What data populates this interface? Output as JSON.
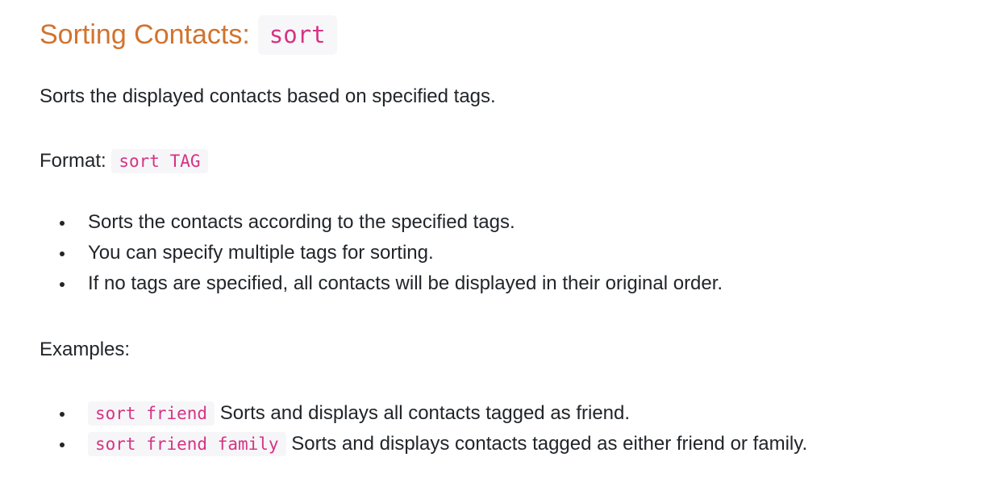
{
  "heading": {
    "title": "Sorting Contacts:",
    "command": "sort"
  },
  "description": "Sorts the displayed contacts based on specified tags.",
  "format": {
    "label": "Format:",
    "code": "sort TAG"
  },
  "notes": [
    "Sorts the contacts according to the specified tags.",
    "You can specify multiple tags for sorting.",
    "If no tags are specified, all contacts will be displayed in their original order."
  ],
  "examples": {
    "label": "Examples:",
    "items": [
      {
        "code": "sort friend",
        "text": "Sorts and displays all contacts tagged as friend."
      },
      {
        "code": "sort friend family",
        "text": "Sorts and displays contacts tagged as either friend or family."
      }
    ]
  },
  "colors": {
    "heading": "#d2732e",
    "code_text": "#d63384",
    "code_background": "#f6f6f8",
    "body_text": "#212529"
  }
}
